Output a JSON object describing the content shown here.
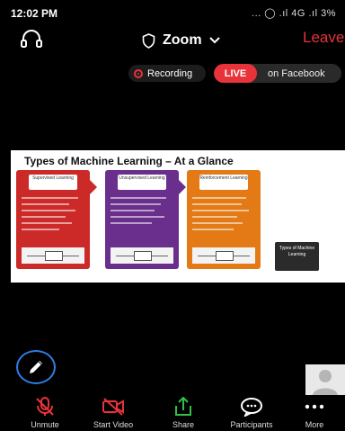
{
  "status_bar": {
    "time": "12:02 PM",
    "indicators": "... ◯ .ıl 4G .ıl 3%"
  },
  "header": {
    "title": "Zoom",
    "leave_label": "Leave"
  },
  "recording": {
    "label": "Recording",
    "live_label": "LIVE",
    "platform_label": "on Facebook"
  },
  "shared_slide": {
    "title": "Types of Machine Learning – At a Glance",
    "cards": [
      {
        "heading": "Supervised Learning",
        "color": "#cc2a28"
      },
      {
        "heading": "Unsupervised Learning",
        "color": "#6a2e8c"
      },
      {
        "heading": "Reinforcement Learning",
        "color": "#e37a16"
      }
    ],
    "side_label": "Types of Machine Learning"
  },
  "toolbar": {
    "items": [
      {
        "label": "Unmute",
        "icon": "microphone-muted-icon"
      },
      {
        "label": "Start Video",
        "icon": "video-off-icon"
      },
      {
        "label": "Share",
        "icon": "share-icon"
      },
      {
        "label": "Participants",
        "icon": "participants-icon"
      },
      {
        "label": "More",
        "icon": "more-icon"
      }
    ]
  },
  "colors": {
    "leave": "#e8333a",
    "live": "#e8333a",
    "share_icon": "#2fbf4a",
    "pencil_ring": "#2f7ee6",
    "muted_icon": "#e8333a"
  }
}
